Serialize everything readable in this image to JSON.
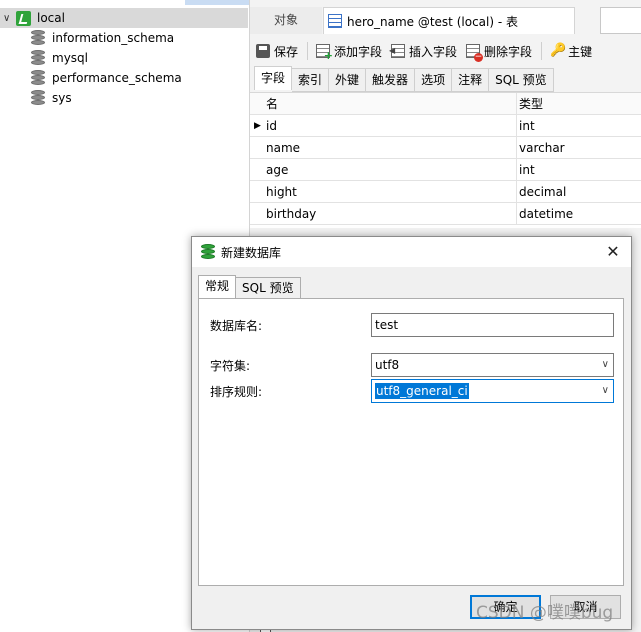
{
  "tree": {
    "connection": {
      "label": "local",
      "expanded": true
    },
    "databases": [
      "information_schema",
      "mysql",
      "performance_schema",
      "sys"
    ]
  },
  "editor": {
    "tabs": {
      "objects": "对象",
      "active": "hero_name @test (local) - 表"
    },
    "toolbar": {
      "save": "保存",
      "add_field": "添加字段",
      "insert_field": "插入字段",
      "delete_field": "删除字段",
      "primary_key": "主键"
    },
    "subtabs": [
      "字段",
      "索引",
      "外键",
      "触发器",
      "选项",
      "注释",
      "SQL 预览"
    ],
    "grid": {
      "headers": {
        "name": "名",
        "type": "类型"
      },
      "rows": [
        {
          "name": "id",
          "type": "int",
          "current": true
        },
        {
          "name": "name",
          "type": "varchar",
          "current": false
        },
        {
          "name": "age",
          "type": "int",
          "current": false
        },
        {
          "name": "hight",
          "type": "decimal",
          "current": false
        },
        {
          "name": "birthday",
          "type": "datetime",
          "current": false
        }
      ]
    }
  },
  "dialog": {
    "title": "新建数据库",
    "tabs": [
      "常规",
      "SQL 预览"
    ],
    "fields": {
      "db_name_label": "数据库名:",
      "db_name_value": "test",
      "charset_label": "字符集:",
      "charset_value": "utf8",
      "collation_label": "排序规则:",
      "collation_value": "utf8_general_ci"
    },
    "buttons": {
      "ok": "确定",
      "cancel": "取消"
    }
  },
  "watermark": "CSDN @噗噗bug",
  "colors": {
    "accent": "#0078d7",
    "connection_green": "#2fa33a",
    "selection_bg": "#d9d9d9"
  }
}
